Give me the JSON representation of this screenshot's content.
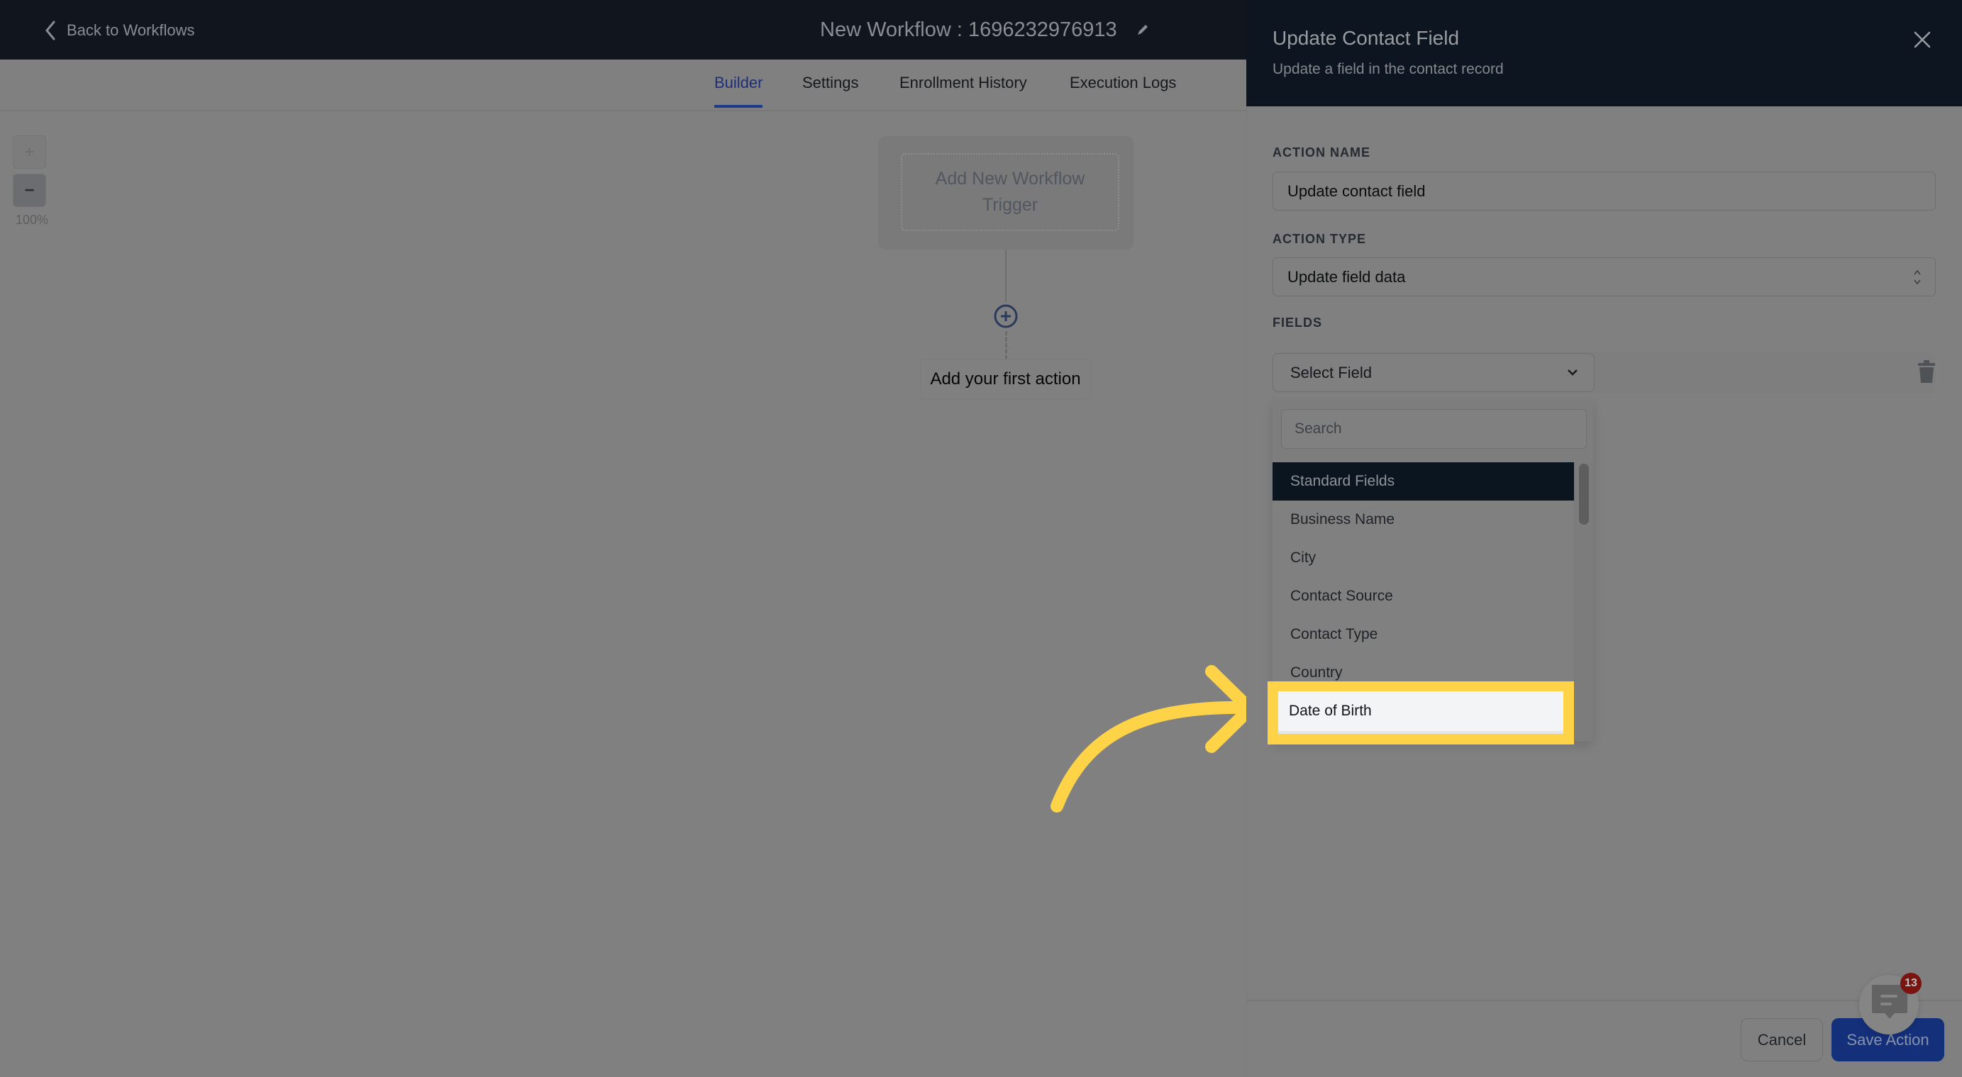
{
  "header": {
    "back_label": "Back to Workflows",
    "workflow_title": "New Workflow : 1696232976913"
  },
  "tabs": [
    {
      "label": "Builder",
      "active": true
    },
    {
      "label": "Settings",
      "active": false
    },
    {
      "label": "Enrollment History",
      "active": false
    },
    {
      "label": "Execution Logs",
      "active": false
    }
  ],
  "canvas": {
    "zoom_in_label": "+",
    "zoom_out_label": "−",
    "zoom_level": "100%",
    "trigger_label": "Add New Workflow Trigger",
    "first_action_label": "Add your first action"
  },
  "panel": {
    "title": "Update Contact Field",
    "subtitle": "Update a field in the contact record",
    "action_name_label": "ACTION NAME",
    "action_name_value": "Update contact field",
    "action_type_label": "ACTION TYPE",
    "action_type_value": "Update field data",
    "fields_label": "FIELDS",
    "select_field_placeholder": "Select Field",
    "search_placeholder": "Search",
    "dropdown_group": "Standard Fields",
    "dropdown_items": [
      "Business Name",
      "City",
      "Contact Source",
      "Contact Type",
      "Country",
      "Date of Birth"
    ],
    "highlighted_item": "Date of Birth",
    "cancel_label": "Cancel",
    "save_label": "Save Action"
  },
  "chat": {
    "badge_count": "13"
  },
  "colors": {
    "highlight": "#ffd347",
    "primary_button": "#1e3a8a",
    "active_tab": "#1e3a8a",
    "header_bg": "#111827"
  }
}
